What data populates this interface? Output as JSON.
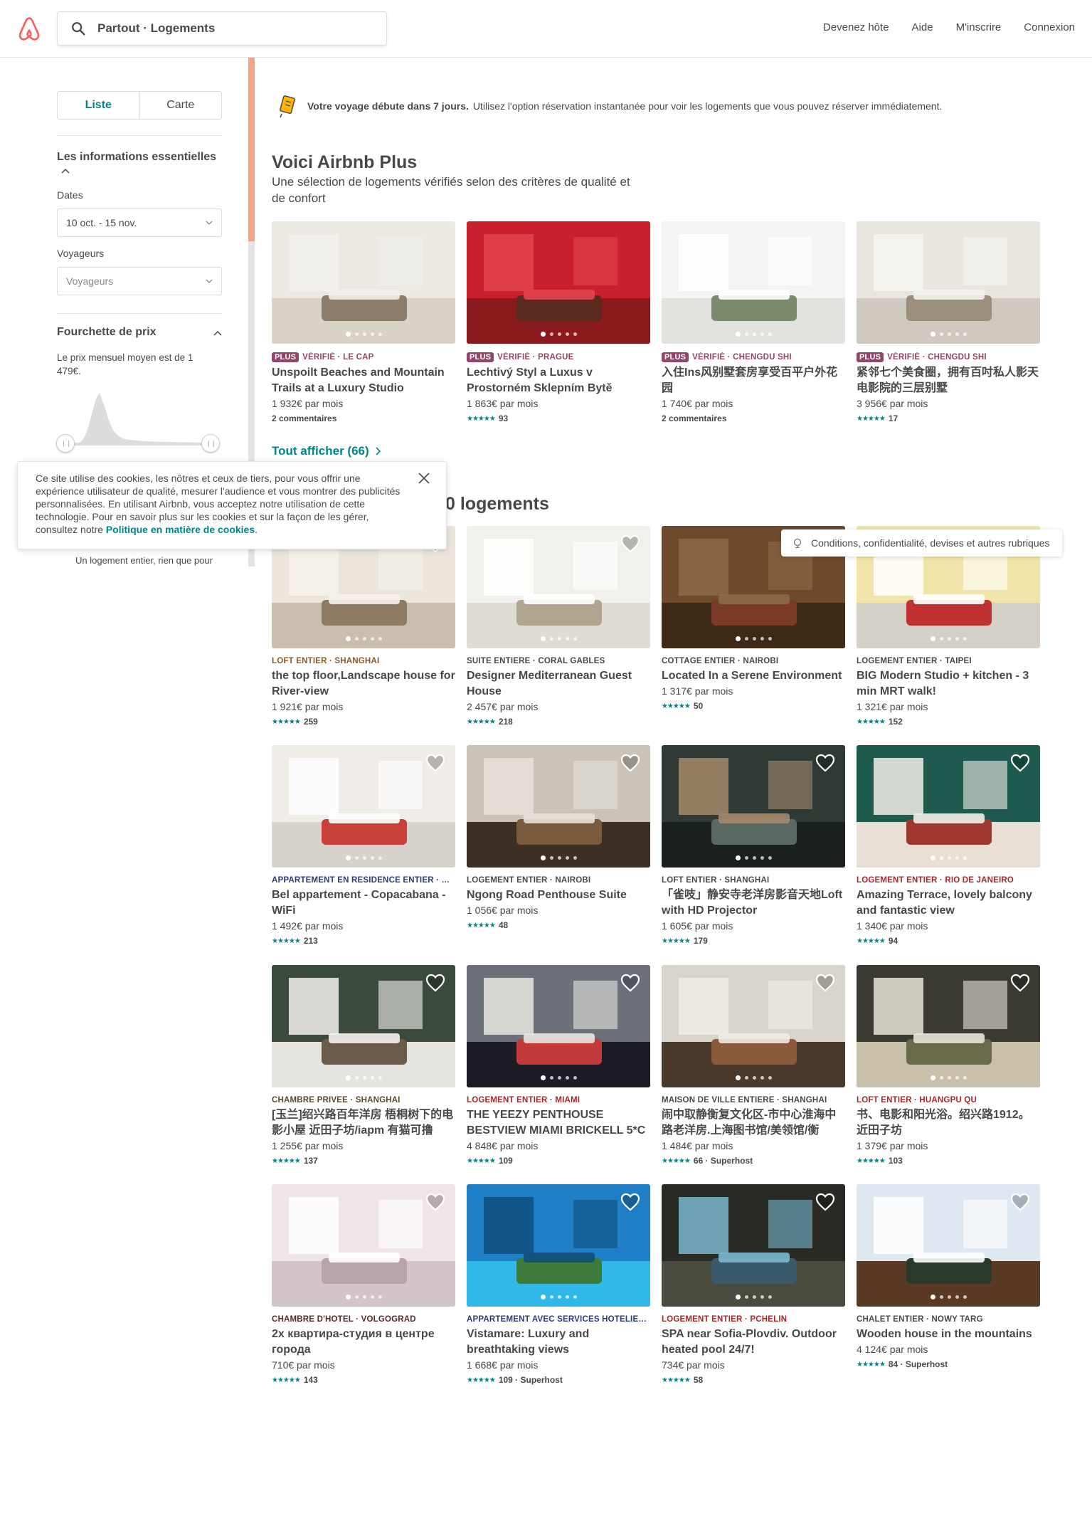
{
  "header": {
    "search_text": "Partout · Logements",
    "nav": [
      "Devenez hôte",
      "Aide",
      "M'inscrire",
      "Connexion"
    ]
  },
  "sidebar": {
    "toggle": {
      "list": "Liste",
      "map": "Carte"
    },
    "essentials_title": "Les informations essentielles",
    "dates_label": "Dates",
    "dates_value": "10 oct. - 15 nov.",
    "travelers_label": "Voyageurs",
    "travelers_placeholder": "Voyageurs",
    "price_title": "Fourchette de prix",
    "price_text": "Le prix mensuel moyen est de 1 479€.",
    "entire_text": "Un logement entier, rien que pour"
  },
  "banner": {
    "bold": "Votre voyage débute dans 7 jours.",
    "rest": "Utilisez l'option réservation instantanée pour voir les logements que vous pouvez réserver immédiatement."
  },
  "plus": {
    "title": "Voici Airbnb Plus",
    "subtitle": "Une sélection de logements vérifiés selon des critères de qualité et de confort",
    "show_all": "Tout afficher (66)",
    "cards": [
      {
        "badge": "PLUS",
        "kind": "VÉRIFIÉ · LE CAP",
        "name": "Unspoilt Beaches and Mountain Trails at a Luxury Studio",
        "price": "1 932€ par mois",
        "reviews": "2 commentaires",
        "stars": false
      },
      {
        "badge": "PLUS",
        "kind": "VÉRIFIÉ · PRAGUE",
        "name": "Lechtivý Styl a Luxus v Prostorném Sklepním Bytě",
        "price": "1 863€ par mois",
        "reviews": "93",
        "stars": true
      },
      {
        "badge": "PLUS",
        "kind": "VÉRIFIÉ · CHENGDU SHI",
        "name": "入住Ins风别墅套房享受百平户外花园",
        "price": "1 740€ par mois",
        "reviews": "2 commentaires",
        "stars": false
      },
      {
        "badge": "PLUS",
        "kind": "VÉRIFIÉ · CHENGDU SHI",
        "name": "紧邻七个美食圈，拥有百吋私人影天电影院的三层别墅",
        "price": "3 956€ par mois",
        "reviews": "17",
        "stars": true
      }
    ]
  },
  "listings": {
    "title_fragment": "0 logements",
    "cards": [
      {
        "kind": "LOFT ENTIER · SHANGHAÏ",
        "name": "the top floor,Landscape house for River-view",
        "price": "1 921€ par mois",
        "reviews": "259"
      },
      {
        "kind": "SUITE ENTIÈRE · CORAL GABLES",
        "name": "Designer Mediterranean Guest House",
        "price": "2 457€ par mois",
        "reviews": "218"
      },
      {
        "kind": "COTTAGE ENTIER · NAIROBI",
        "name": "Located In a Serene Environment",
        "price": "1 317€ par mois",
        "reviews": "50"
      },
      {
        "kind": "LOGEMENT ENTIER · TAIPEI",
        "name": "BIG Modern Studio + kitchen - 3 min MRT walk!",
        "price": "1 321€ par mois",
        "reviews": "152"
      },
      {
        "kind": "APPARTEMENT EN RÉSIDENCE ENTIER · RI...",
        "name": "Bel appartement - Copacabana - WiFi",
        "price": "1 492€ par mois",
        "reviews": "213"
      },
      {
        "kind": "LOGEMENT ENTIER · NAIROBI",
        "name": "Ngong Road Penthouse Suite",
        "price": "1 056€ par mois",
        "reviews": "48"
      },
      {
        "kind": "LOFT ENTIER · SHANGHAI",
        "name": "「雀吱」静安寺老洋房影音天地Loft with HD Projector",
        "price": "1 605€ par mois",
        "reviews": "179"
      },
      {
        "kind": "LOGEMENT ENTIER · RIO DE JANEIRO",
        "name": "Amazing Terrace, lovely balcony and fantastic view",
        "price": "1 340€ par mois",
        "reviews": "94"
      },
      {
        "kind": "CHAMBRE PRIVÉE · SHANGHAI",
        "name": "[玉兰]绍兴路百年洋房 梧桐树下的电影小屋 近田子坊/iapm 有猫可撸",
        "price": "1 255€ par mois",
        "reviews": "137"
      },
      {
        "kind": "LOGEMENT ENTIER · MIAMI",
        "name": "THE YEEZY PENTHOUSE BESTVIEW MIAMI BRICKELL 5*C",
        "price": "4 848€ par mois",
        "reviews": "109"
      },
      {
        "kind": "MAISON DE VILLE ENTIÈRE · SHANGHAI",
        "name": "闹中取静衡复文化区-市中心淮海中路老洋房.上海图书馆/美领馆/衡",
        "price": "1 484€ par mois",
        "reviews": "66 · Superhost"
      },
      {
        "kind": "LOFT ENTIER · HUANGPU QU",
        "name": "书、电影和阳光浴。绍兴路1912。近田子坊",
        "price": "1 379€ par mois",
        "reviews": "103"
      },
      {
        "kind": "CHAMBRE D'HÔTEL · VOLGOGRAD",
        "name": "2х квартира-студия в центре города",
        "price": "710€ par mois",
        "reviews": "143"
      },
      {
        "kind": "APPARTEMENT AVEC SERVICES HÔTELIER...",
        "name": "Vistamare: Luxury and breathtaking views",
        "price": "1 668€ par mois",
        "reviews": "109 · Superhost"
      },
      {
        "kind": "LOGEMENT ENTIER · PCHELIN",
        "name": "SPA near Sofia-Plovdiv. Outdoor heated pool 24/7!",
        "price": "734€ par mois",
        "reviews": "58"
      },
      {
        "kind": "CHALET ENTIER · NOWY TARG",
        "name": "Wooden house in the mountains",
        "price": "4 124€ par mois",
        "reviews": "84 · Superhost"
      }
    ]
  },
  "cookie": {
    "text": "Ce site utilise des cookies, les nôtres et ceux de tiers, pour vous offrir une expérience utilisateur de qualité, mesurer l'audience et vous montrer des publicités personnalisées. En utilisant Airbnb, vous acceptez notre utilisation de cette technologie. Pour en savoir plus sur les cookies et sur la façon de les gérer, consultez notre",
    "link": "Politique en matière de cookies",
    "end": "."
  },
  "footer_pill": "Conditions, confidentialité, devises et autres rubriques",
  "colors": {
    "accent": "#008489",
    "brand": "#FF5A5F",
    "plus": "#914669"
  }
}
